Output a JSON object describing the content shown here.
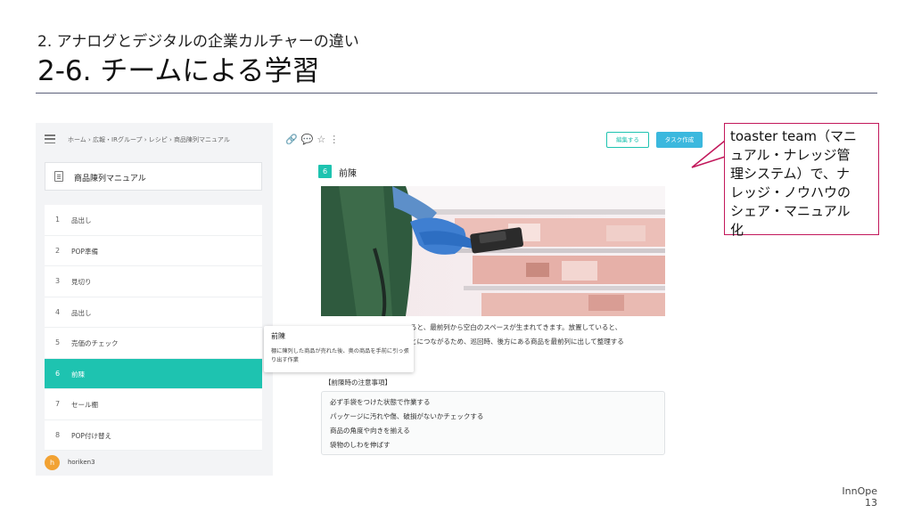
{
  "slide": {
    "subtitle": "2. アナログとデジタルの企業カルチャーの違い",
    "title": "2-6. チームによる学習",
    "brand": "InnOpe",
    "page_number": "13"
  },
  "app": {
    "breadcrumb": "ホーム › 広報・IRグループ › レシピ › 商品陳列マニュアル",
    "document_title": "商品陳列マニュアル",
    "steps": [
      {
        "num": "1",
        "label": "品出し"
      },
      {
        "num": "2",
        "label": "POP準備"
      },
      {
        "num": "3",
        "label": "見切り"
      },
      {
        "num": "4",
        "label": "品出し"
      },
      {
        "num": "5",
        "label": "売価のチェック"
      },
      {
        "num": "6",
        "label": "前陳"
      },
      {
        "num": "7",
        "label": "セール棚"
      },
      {
        "num": "8",
        "label": "POP付け替え"
      }
    ],
    "active_step": 6,
    "user": {
      "initial": "h",
      "name": "horiken3"
    },
    "tooltip": {
      "title": "前陳",
      "body": "棚に陳列した商品が売れた後、奥の商品を手前に引っ張り出す作業"
    },
    "buttons": {
      "edit": "編集する",
      "task": "タスク作成"
    },
    "content": {
      "step_num": "6",
      "step_title": "前陳",
      "body_line1": "ると、最前列から空白のスペースが生まれてきます。放置していると、",
      "body_line2": "とにつながるため、巡回時、後方にある商品を最前列に出して整理する",
      "notice_heading": "【前陳時の注意事項】",
      "notice_items": [
        "必ず手袋をつけた状態で作業する",
        "パッケージに汚れや傷、破損がないかチェックする",
        "商品の角度や向きを揃える",
        "袋物のしわを伸ばす"
      ]
    }
  },
  "callout": {
    "lines": [
      "toaster team（マニ",
      "ュアル・ナレッジ管",
      "理システム）で、ナ",
      "レッジ・ノウハウの",
      "シェア・マニュアル",
      "化"
    ]
  },
  "colors": {
    "accent": "#1ec3b0",
    "task_button": "#3bb8de",
    "callout_border": "#c2185b",
    "avatar": "#f2a233"
  }
}
